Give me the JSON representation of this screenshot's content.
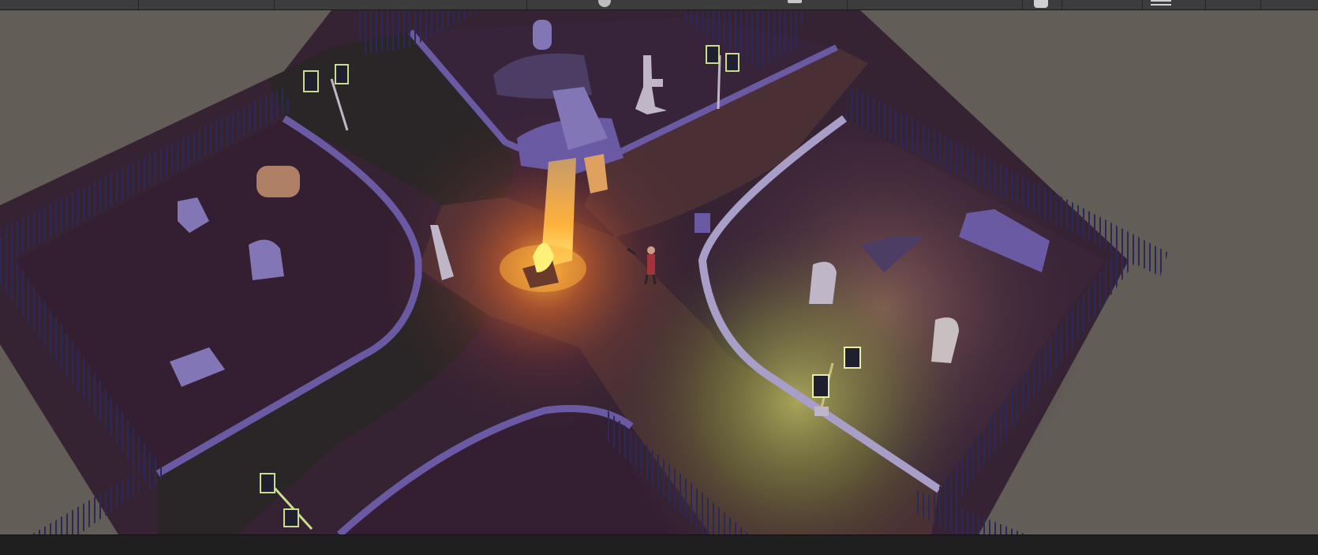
{
  "toolbar": {
    "segments": [],
    "icons": [
      "gizmo-sphere-icon",
      "menu-icon"
    ]
  },
  "scene": {
    "colors": {
      "background": "#625d57",
      "ground": "#352233",
      "path": "#4a3034",
      "path_dark": "#2a2526",
      "grass_glow": "#9db44a",
      "fire": "#ff9a22",
      "curb": "#6a5aa4",
      "fence": "#2c2858",
      "stone": "#8276b6"
    }
  }
}
